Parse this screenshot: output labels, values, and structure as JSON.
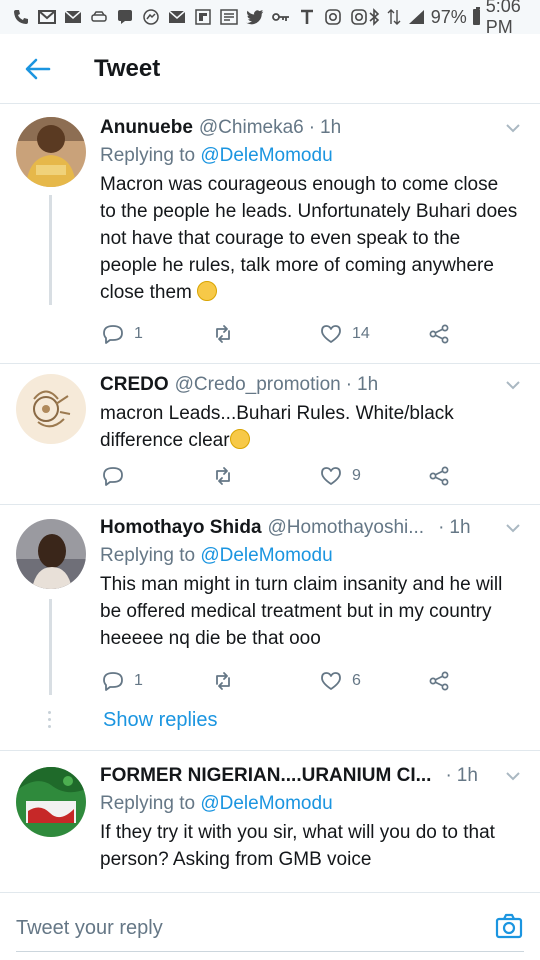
{
  "status_bar": {
    "battery": "97%",
    "time": "5:06 PM",
    "icons": [
      "phone-icon",
      "mail-icon",
      "mail-icon",
      "car-icon",
      "chat-icon",
      "messenger-icon",
      "mail-icon",
      "flipboard-icon",
      "news-icon",
      "twitter-icon",
      "key-icon",
      "t-icon",
      "instagram-icon",
      "instagram-icon",
      "bluetooth-icon",
      "signal-icon",
      "battery-icon"
    ]
  },
  "header": {
    "title": "Tweet"
  },
  "replies": [
    {
      "name": "Anunuebe",
      "handle": "@Chimeka6",
      "dot": "·",
      "time": "1h",
      "replying_prefix": "Replying to",
      "replying_to": "@DeleMomodu",
      "text": "Macron was courageous enough to come close to the people he leads. Unfortunately Buhari does not have that courage to even speak to the people he rules, talk more of coming anywhere close them",
      "reply_count": "1",
      "retweet_count": "",
      "like_count": "14"
    },
    {
      "name": "CREDO",
      "handle": "@Credo_promotion",
      "dot": "·",
      "time": "1h",
      "text": "macron Leads...Buhari Rules. White/black difference clear",
      "reply_count": "",
      "retweet_count": "",
      "like_count": "9"
    },
    {
      "name": "Homothayo Shida",
      "handle": "@Homothayoshi...",
      "dot": "·",
      "time": "1h",
      "replying_prefix": "Replying to",
      "replying_to": "@DeleMomodu",
      "text": "This man might in turn claim insanity and he will be offered medical treatment but in my country heeeee nq die be that ooo",
      "reply_count": "1",
      "retweet_count": "",
      "like_count": "6"
    },
    {
      "name": "FORMER NIGERIAN....URANIUM CI...",
      "handle": "",
      "dot": "·",
      "time": "1h",
      "replying_prefix": "Replying to",
      "replying_to": "@DeleMomodu",
      "text": "If they try it with you sir, what will you do to that person? Asking from GMB voice"
    }
  ],
  "show_replies": "Show replies",
  "compose": {
    "placeholder": "Tweet your reply"
  },
  "colors": {
    "accent": "#1b95e0",
    "muted": "#657786",
    "text": "#14171a",
    "divider": "#e1e8ed"
  }
}
